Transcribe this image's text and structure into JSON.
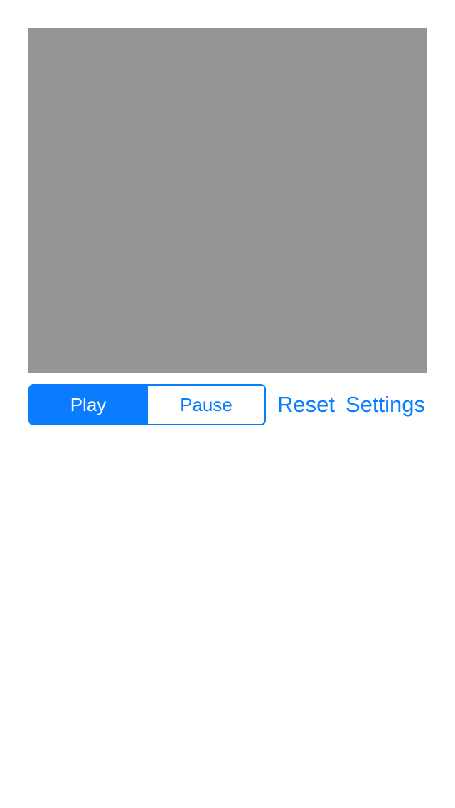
{
  "colors": {
    "accent": "#0a7cff",
    "canvas": "#959595",
    "background": "#ffffff"
  },
  "controls": {
    "mode_segments": [
      {
        "label": "Play",
        "selected": true
      },
      {
        "label": "Pause",
        "selected": false
      }
    ],
    "reset_label": "Reset",
    "settings_label": "Settings"
  }
}
